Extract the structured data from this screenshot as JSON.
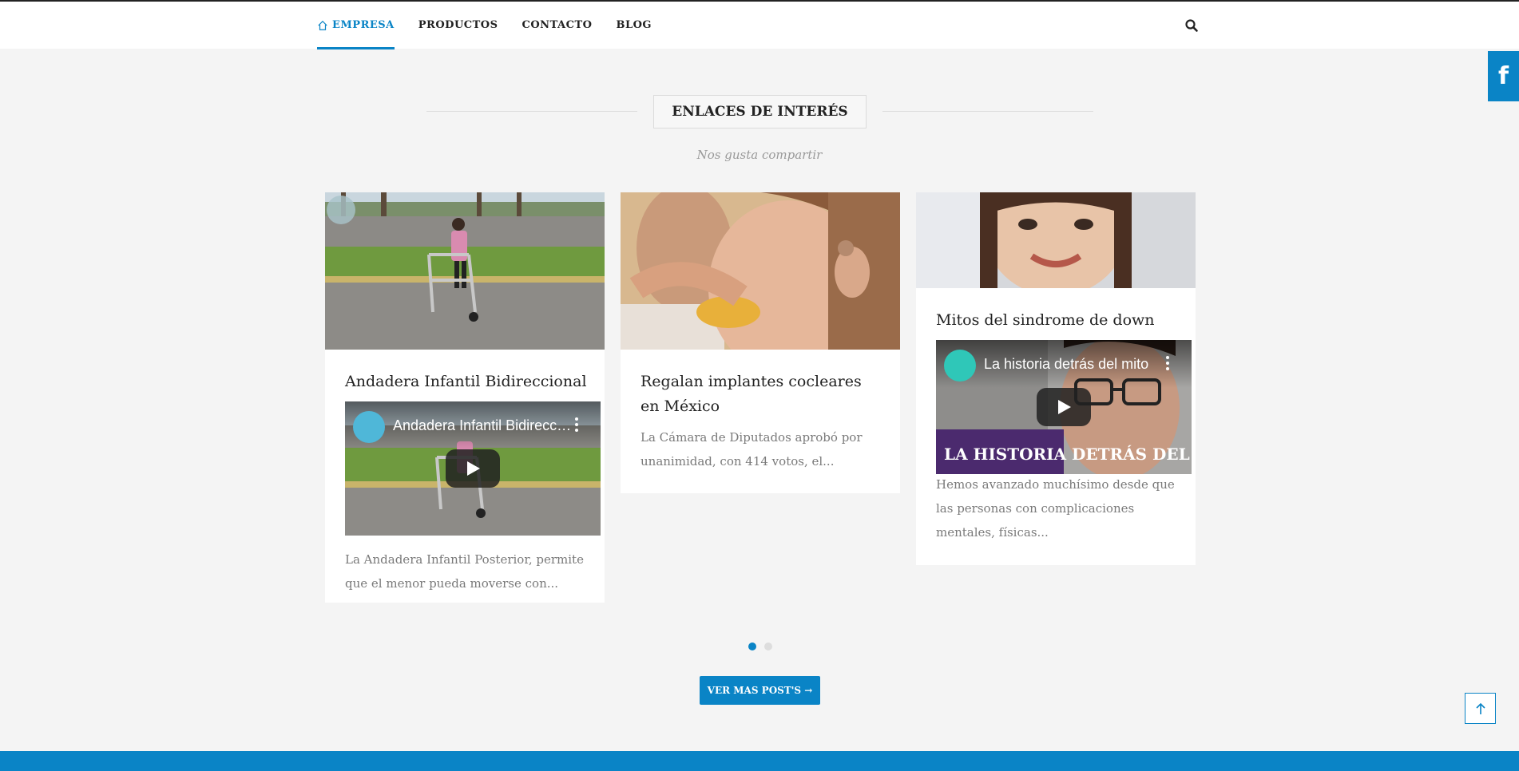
{
  "nav": {
    "items": [
      {
        "label": "EMPRESA",
        "active": true
      },
      {
        "label": "PRODUCTOS",
        "active": false
      },
      {
        "label": "CONTACTO",
        "active": false
      },
      {
        "label": "BLOG",
        "active": false
      }
    ],
    "search_icon": "search-icon"
  },
  "social": {
    "facebook_label": "f"
  },
  "section": {
    "title": "ENLACES DE INTERÉS",
    "subtitle": "Nos gusta compartir"
  },
  "posts": [
    {
      "title": "Andadera Infantil Bidireccional",
      "video_title": "Andadera Infantil Bidireccional",
      "excerpt": "La Andadera Infantil Posterior, permite que el menor pueda moverse con..."
    },
    {
      "title": "Regalan implantes cocleares en México",
      "excerpt": "La Cámara de Diputados aprobó por unanimidad, con 414 votos, el..."
    },
    {
      "title": "Mitos del sindrome de down",
      "video_title": "La historia detrás del mito",
      "video_overlay_text": "LA HISTORIA DETRÁS DEL MITO",
      "excerpt": "Hemos avanzado muchísimo desde que las personas con complicaciones mentales, físicas..."
    }
  ],
  "carousel": {
    "pages": 2,
    "current": 1
  },
  "more_button": "VER MAS POST'S →",
  "colors": {
    "accent": "#0a84c6",
    "background": "#f4f4f4"
  }
}
